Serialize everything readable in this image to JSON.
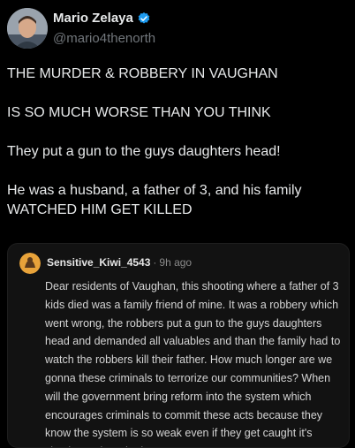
{
  "author": {
    "name": "Mario Zelaya",
    "handle": "@mario4thenorth",
    "verified_color": "#1d9bf0"
  },
  "post": {
    "paragraphs": [
      "THE MURDER & ROBBERY IN VAUGHAN",
      "IS SO MUCH WORSE THAN YOU THINK",
      "They put a gun to the guys daughters head!",
      "He was a husband, a father of 3, and his family\nWATCHED HIM GET KILLED"
    ]
  },
  "quoted": {
    "username": "Sensitive_Kiwi_4543",
    "separator": "·",
    "time": "9h ago",
    "body": "Dear residents of Vaughan, this shooting where a father of 3 kids died was a family friend of mine. It was a robbery which went wrong, the robbers put a gun to the guys daughters head and demanded all valuables and than the family had to watch the robbers kill their father. How much longer are we gonna these criminals to terrorize our communities? When will the government bring reform into the system which encourages criminals to commit these acts because they know the system is so weak even if they get caught it's simple catch and release!!",
    "avatar_color": "#e8a33a"
  }
}
